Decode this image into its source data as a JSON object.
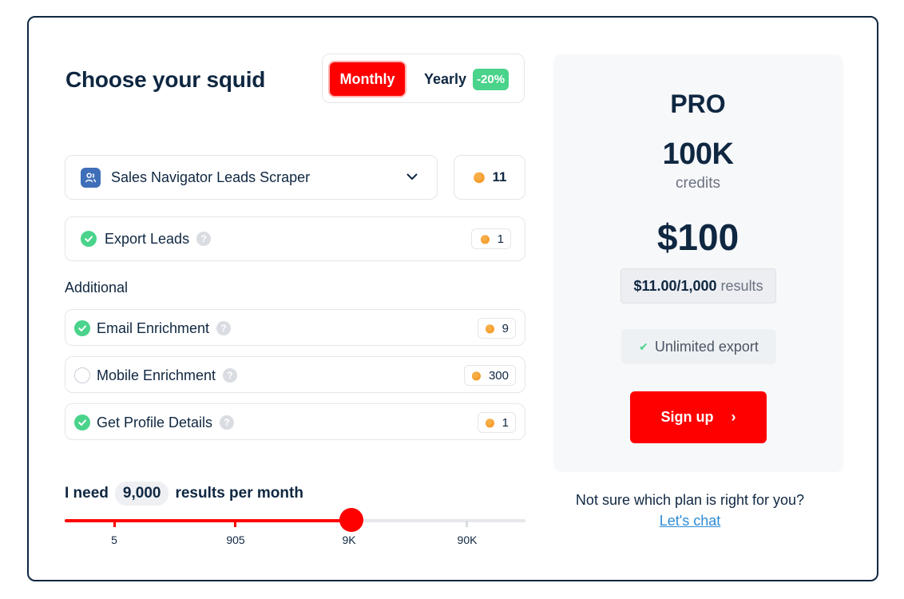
{
  "heading": "Choose your squid",
  "billing_toggle": {
    "monthly_label": "Monthly",
    "yearly_label": "Yearly",
    "yearly_discount": "-20%",
    "selected": "Monthly",
    "active_color": "#ff0000",
    "discount_color": "#4ad38b"
  },
  "scraper": {
    "selected": "Sales Navigator Leads Scraper",
    "credits": "11",
    "icon": "users-icon"
  },
  "base_option": {
    "label": "Export Leads",
    "checked": true,
    "credits": "1"
  },
  "additional_heading": "Additional",
  "additional_options": [
    {
      "label": "Email Enrichment",
      "checked": true,
      "credits": "9"
    },
    {
      "label": "Mobile Enrichment",
      "checked": false,
      "credits": "300"
    },
    {
      "label": "Get Profile Details",
      "checked": true,
      "credits": "1"
    }
  ],
  "results": {
    "prefix": "I need",
    "value": "9,000",
    "suffix": "results per month",
    "tick_labels": [
      "5",
      "905",
      "9K",
      "90K"
    ],
    "selected_tick": "9K"
  },
  "plan": {
    "name": "PRO",
    "credits_amount": "100K",
    "credits_label": "credits",
    "price": "$100",
    "per_results_price": "$11.00/1,000",
    "per_results_label": "results",
    "feature": "Unlimited export",
    "cta": "Sign up",
    "cta_color": "#ff0000"
  },
  "help": {
    "question": "Not sure which plan is right for you?",
    "link": "Let's chat"
  }
}
